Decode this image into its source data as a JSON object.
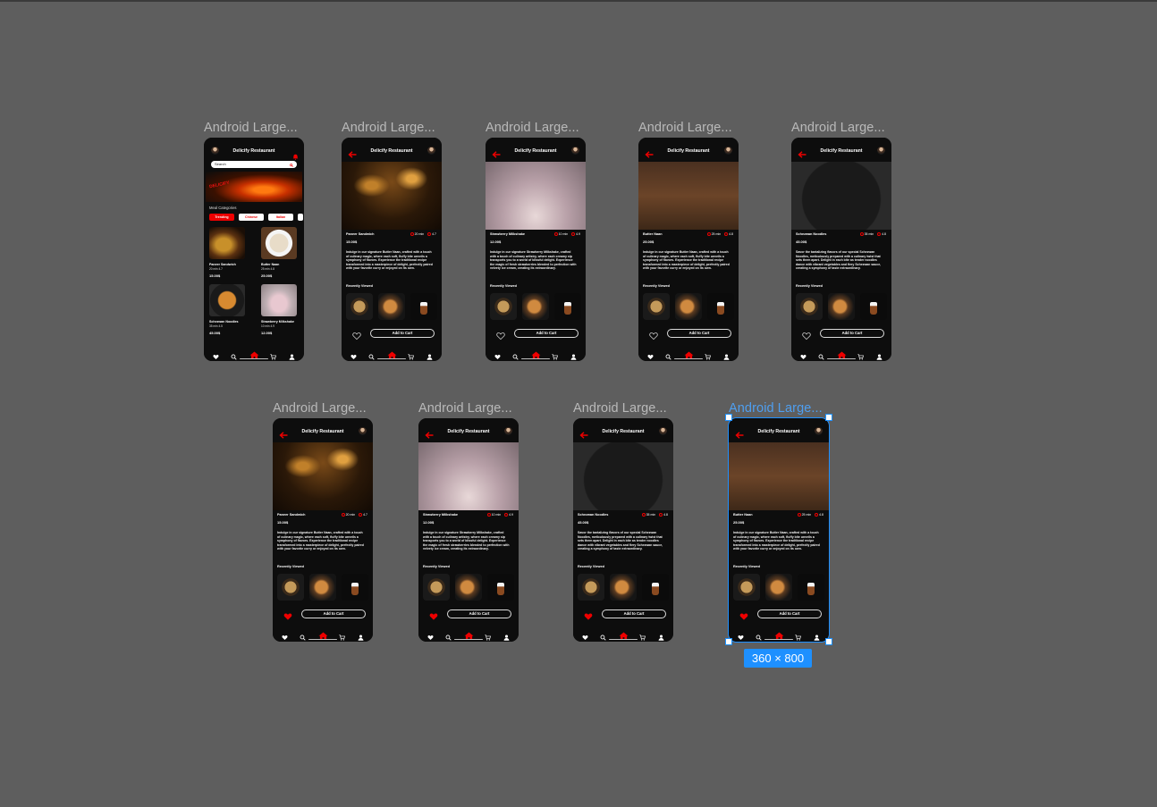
{
  "frames": {
    "label": "Android Large..."
  },
  "app": {
    "title": "Delicify Restaurant",
    "search_placeholder": "Search",
    "banner_tag": "DELICIFY",
    "meal_categories": "Meal Categories",
    "categories": [
      "Trending",
      "Chinese",
      "Italian"
    ],
    "add_to_cart": "Add to Cart",
    "recently_viewed": "Recently Viewed",
    "nav": [
      "favorites",
      "search",
      "home",
      "cart",
      "profile"
    ]
  },
  "home_cards": [
    {
      "name": "Paneer Sandwich",
      "time": "20 min",
      "rating": "4.7",
      "price": "15.00$"
    },
    {
      "name": "Butter Naan",
      "time": "25 min",
      "rating": "4.8",
      "price": "25.00$"
    },
    {
      "name": "Schezwan Noodles",
      "time": "35 min",
      "rating": "4.5",
      "price": "45.00$"
    },
    {
      "name": "Strawberry Milkshake",
      "time": "10 min",
      "rating": "4.9",
      "price": "12.00$"
    }
  ],
  "details": {
    "sandwich": {
      "name": "Paneer Sandwich",
      "time": "20 min",
      "rating": "4.7",
      "price": "15.00$",
      "desc": "Indulge in our signature Butter Naan, crafted with a touch of culinary magic, where each soft, fluffy bite unveils a symphony of flavors. Experience the traditional recipe transformed into a masterpiece of delight, perfectly paired with your favorite curry or enjoyed on its own."
    },
    "shake": {
      "name": "Strawberry Milkshake",
      "time": "10 min",
      "rating": "4.9",
      "price": "12.00$",
      "desc": "Indulge in our signature Strawberry Milkshake, crafted with a touch of culinary artistry, where each creamy sip transports you to a world of blissful delight. Experience the magic of fresh strawberries blended to perfection with velvety ice cream, creating its extraordinary."
    },
    "naan": {
      "name": "Butter Naan",
      "time": "25 min",
      "rating": "4.8",
      "price": "25.00$",
      "desc": "Indulge in our signature Butter Naan, crafted with a touch of culinary magic, where each soft, fluffy bite unveils a symphony of flavors. Experience the traditional recipe transformed into a masterpiece of delight, perfectly paired with your favorite curry or enjoyed on its own."
    },
    "noodles": {
      "name": "Schezwan Noodles",
      "time": "35 min",
      "rating": "4.8",
      "price": "45.00$",
      "desc": "Savor the tantalizing flavors of our special Schezwan Noodles, meticulously prepared with a culinary twist that sets them apart. Delight in each bite as tender noodles dance with vibrant vegetables and fiery Schezwan sauce, creating a symphony of taste extraordinary."
    }
  },
  "selection": {
    "size": "360 × 800"
  },
  "colors": {
    "canvas": "#5e5e5e",
    "accent": "#e00000",
    "selection": "#1e90ff"
  }
}
